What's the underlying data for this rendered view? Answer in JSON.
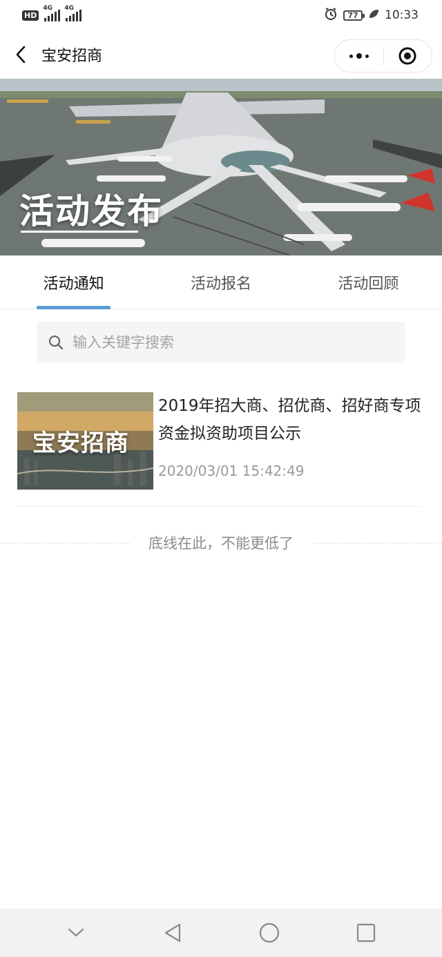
{
  "status_bar": {
    "hd": "HD",
    "net1": "4G",
    "net2": "4G",
    "battery": "77",
    "time": "10:33"
  },
  "nav": {
    "title": "宝安招商"
  },
  "banner": {
    "title": "活动发布"
  },
  "tabs": [
    {
      "label": "活动通知",
      "active": true
    },
    {
      "label": "活动报名",
      "active": false
    },
    {
      "label": "活动回顾",
      "active": false
    }
  ],
  "search": {
    "placeholder": "输入关键字搜索",
    "value": ""
  },
  "items": [
    {
      "thumb_text": "宝安招商",
      "title": "2019年招大商、招优商、招好商专项资金拟资助项目公示",
      "date": "2020/03/01 15:42:49"
    }
  ],
  "end_text": "底线在此，不能更低了",
  "colors": {
    "accent": "#5b9bd5",
    "muted_text": "#9a9a9a",
    "search_bg": "#f4f5f7"
  }
}
